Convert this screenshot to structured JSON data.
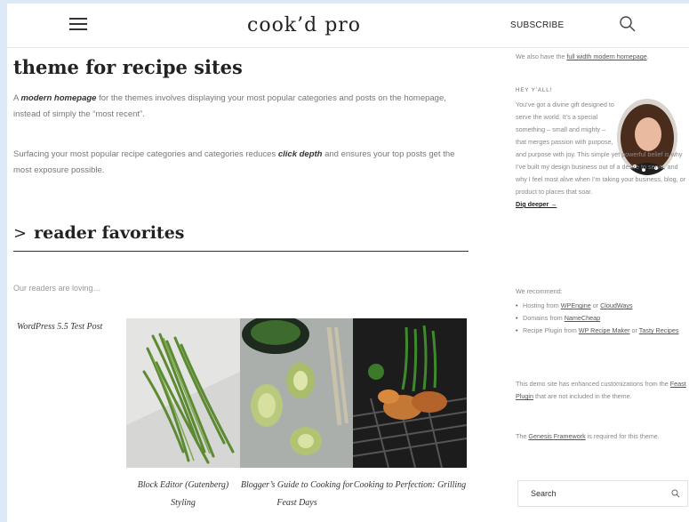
{
  "header": {
    "menu_icon": "hamburger-menu-icon",
    "logo": "cook’d pro",
    "subscribe_label": "SUBSCRIBE",
    "search_icon": "search-icon"
  },
  "main": {
    "intro_title": "theme for recipe sites",
    "para1_a": "A ",
    "para1_em": "modern homepage",
    "para1_b": " for the themes involves displaying your most popular categories and posts on the homepage, instead of simply the “most recent”.",
    "para2_a": "Surfacing your most popular recipe categories and categories reduces ",
    "para2_em": "click depth",
    "para2_b": " and ensures your top posts get the most exposure possible.",
    "section_chevron": ">",
    "section_title": "reader favorites",
    "loving_text": "Our readers are loving…",
    "posts": [
      {
        "title": "WordPress 5.5 Test Post"
      },
      {
        "title": "Block Editor (Gutenberg) Styling"
      },
      {
        "title": "Blogger’s Guide to Cooking for Feast Days"
      },
      {
        "title": "Cooking to Perfection: Grilling"
      }
    ]
  },
  "sidebar": {
    "top_text": "We also have the ",
    "top_link": "full width modern homepage",
    "top_end": ".",
    "hey_label": "HEY Y'ALL!",
    "hey_text_float": "You’ve got a divine gift designed to serve the world. It’s a special something – small and mighty – that merges passion with purpose,",
    "hey_text_full": "and purpose with joy. This simple yet powerful belief is why I’ve built my design business out of a desire to serve, and why I feel most alive when I’m taking your business, blog, or product to places that soar.",
    "dig_deeper": "Dig deeper →",
    "recommend_label": "We recommend:",
    "rec_items": [
      {
        "pre": "Hosting from ",
        "link1": "WPEngine",
        "mid": " or ",
        "link2": "CloudWays",
        "post": ""
      },
      {
        "pre": "Domains from ",
        "link1": "NameCheap",
        "mid": "",
        "link2": "",
        "post": ""
      },
      {
        "pre": "Recipe Plugin from ",
        "link1": "WP Recipe Maker",
        "mid": " or ",
        "link2": "Tasty Recipes",
        "post": ""
      }
    ],
    "demo_a": "This demo site has enhanced customizations from the ",
    "demo_link": "Feast Plugin",
    "demo_b": " that are not included in the theme.",
    "genesis_a": "The ",
    "genesis_link": "Genesis Framework",
    "genesis_b": " is required for this theme.",
    "search_placeholder": "Search"
  },
  "colors": {
    "frame": "#dce9f6",
    "text": "#333333",
    "muted": "#888888"
  }
}
